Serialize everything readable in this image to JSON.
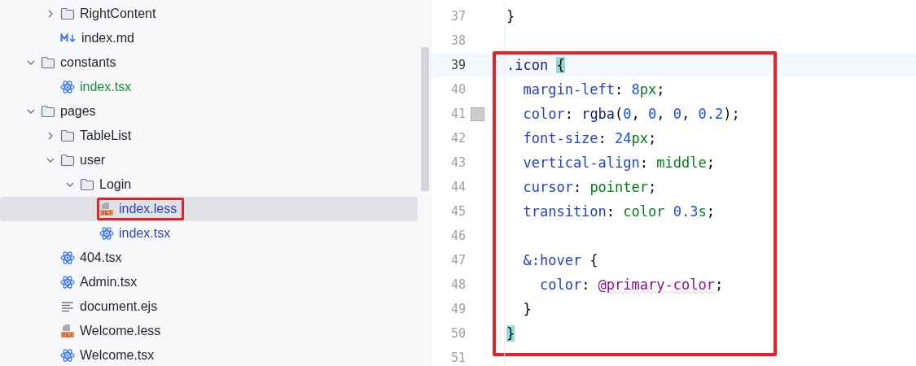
{
  "project_tree": {
    "items": [
      {
        "children": [
          {
            "name": "RightContent",
            "kind": "folder",
            "expanded": false,
            "selected": false,
            "color": "#1f2329",
            "framed": false
          },
          {
            "name": "index.md",
            "kind": "markdown",
            "selected": false,
            "color": "#1f2329",
            "framed": false
          }
        ]
      },
      {
        "name": "constants",
        "kind": "folder",
        "expanded": true,
        "selected": false,
        "color": "#1f2329",
        "framed": false,
        "children": [
          {
            "name": "index.tsx",
            "kind": "react",
            "selected": false,
            "color": "#1e8a38",
            "framed": false
          }
        ]
      },
      {
        "name": "pages",
        "kind": "folder",
        "expanded": true,
        "selected": false,
        "color": "#1f2329",
        "framed": false,
        "children": [
          {
            "name": "TableList",
            "kind": "folder",
            "expanded": false,
            "selected": false,
            "color": "#1f2329",
            "framed": false
          },
          {
            "name": "user",
            "kind": "folder",
            "expanded": true,
            "selected": false,
            "color": "#1f2329",
            "framed": false,
            "children": [
              {
                "name": "Login",
                "kind": "folder",
                "expanded": true,
                "selected": false,
                "color": "#1f2329",
                "framed": false,
                "children": [
                  {
                    "name": "index.less",
                    "kind": "less",
                    "selected": true,
                    "color": "#2b45c4",
                    "framed": true
                  },
                  {
                    "name": "index.tsx",
                    "kind": "react",
                    "selected": false,
                    "color": "#2b45c4",
                    "framed": false
                  }
                ]
              }
            ]
          },
          {
            "name": "404.tsx",
            "kind": "react",
            "selected": false,
            "color": "#1f2329",
            "framed": false
          },
          {
            "name": "Admin.tsx",
            "kind": "react",
            "selected": false,
            "color": "#1f2329",
            "framed": false
          },
          {
            "name": "document.ejs",
            "kind": "text",
            "selected": false,
            "color": "#1f2329",
            "framed": false
          },
          {
            "name": "Welcome.less",
            "kind": "less",
            "selected": false,
            "color": "#1f2329",
            "framed": false
          },
          {
            "name": "Welcome.tsx",
            "kind": "react",
            "selected": false,
            "color": "#1f2329",
            "framed": false
          }
        ]
      }
    ]
  },
  "editor": {
    "segments": [
      {
        "framed": false,
        "lines": [
          {
            "number": "37",
            "current": false,
            "tokens": [
              {
                "text": "}",
                "kind": "punct"
              }
            ]
          },
          {
            "number": "38",
            "current": false
          }
        ]
      },
      {
        "framed": true,
        "lines": [
          {
            "number": "39",
            "current": true,
            "tokens": [
              {
                "text": ".icon ",
                "kind": "selector"
              },
              {
                "text": "{",
                "kind": "brace_match"
              }
            ]
          },
          {
            "number": "40",
            "current": false,
            "tokens": [
              {
                "text": "  margin-left",
                "kind": "property"
              },
              {
                "text": ": ",
                "kind": "punct"
              },
              {
                "text": "8",
                "kind": "number"
              },
              {
                "text": "px",
                "kind": "keyword"
              },
              {
                "text": ";",
                "kind": "punct"
              }
            ]
          },
          {
            "number": "41",
            "current": false,
            "color": "#cccccc",
            "tokens": [
              {
                "text": "  color",
                "kind": "property"
              },
              {
                "text": ": ",
                "kind": "punct"
              },
              {
                "text": "rgba",
                "kind": "function"
              },
              {
                "text": "(",
                "kind": "punct"
              },
              {
                "text": "0",
                "kind": "number"
              },
              {
                "text": ", ",
                "kind": "punct"
              },
              {
                "text": "0",
                "kind": "number"
              },
              {
                "text": ", ",
                "kind": "punct"
              },
              {
                "text": "0",
                "kind": "number"
              },
              {
                "text": ", ",
                "kind": "punct"
              },
              {
                "text": "0.2",
                "kind": "number"
              },
              {
                "text": ");",
                "kind": "punct"
              }
            ]
          },
          {
            "number": "42",
            "current": false,
            "tokens": [
              {
                "text": "  font-size",
                "kind": "property"
              },
              {
                "text": ": ",
                "kind": "punct"
              },
              {
                "text": "24",
                "kind": "number"
              },
              {
                "text": "px",
                "kind": "keyword"
              },
              {
                "text": ";",
                "kind": "punct"
              }
            ]
          },
          {
            "number": "43",
            "current": false,
            "tokens": [
              {
                "text": "  vertical-align",
                "kind": "property"
              },
              {
                "text": ": ",
                "kind": "punct"
              },
              {
                "text": "middle",
                "kind": "keyword"
              },
              {
                "text": ";",
                "kind": "punct"
              }
            ]
          },
          {
            "number": "44",
            "current": false,
            "tokens": [
              {
                "text": "  cursor",
                "kind": "property"
              },
              {
                "text": ": ",
                "kind": "punct"
              },
              {
                "text": "pointer",
                "kind": "keyword"
              },
              {
                "text": ";",
                "kind": "punct"
              }
            ]
          },
          {
            "number": "45",
            "current": false,
            "tokens": [
              {
                "text": "  transition",
                "kind": "property"
              },
              {
                "text": ": ",
                "kind": "punct"
              },
              {
                "text": "color ",
                "kind": "keyword"
              },
              {
                "text": "0.3",
                "kind": "number"
              },
              {
                "text": "s",
                "kind": "keyword"
              },
              {
                "text": ";",
                "kind": "punct"
              }
            ]
          },
          {
            "number": "46",
            "current": false
          },
          {
            "number": "47",
            "current": false,
            "tokens": [
              {
                "text": "  &:hover",
                "kind": "property"
              },
              {
                "text": " {",
                "kind": "punct"
              }
            ]
          },
          {
            "number": "48",
            "current": false,
            "tokens": [
              {
                "text": "    color",
                "kind": "property"
              },
              {
                "text": ": ",
                "kind": "punct"
              },
              {
                "text": "@primary-color",
                "kind": "variable"
              },
              {
                "text": ";",
                "kind": "punct"
              }
            ]
          },
          {
            "number": "49",
            "current": false,
            "tokens": [
              {
                "text": "  }",
                "kind": "punct"
              }
            ]
          },
          {
            "number": "50",
            "current": false,
            "tokens": [
              {
                "text": "}",
                "kind": "brace_match"
              }
            ]
          }
        ]
      },
      {
        "framed": false,
        "lines": [
          {
            "number": "51",
            "current": false
          }
        ]
      }
    ]
  }
}
